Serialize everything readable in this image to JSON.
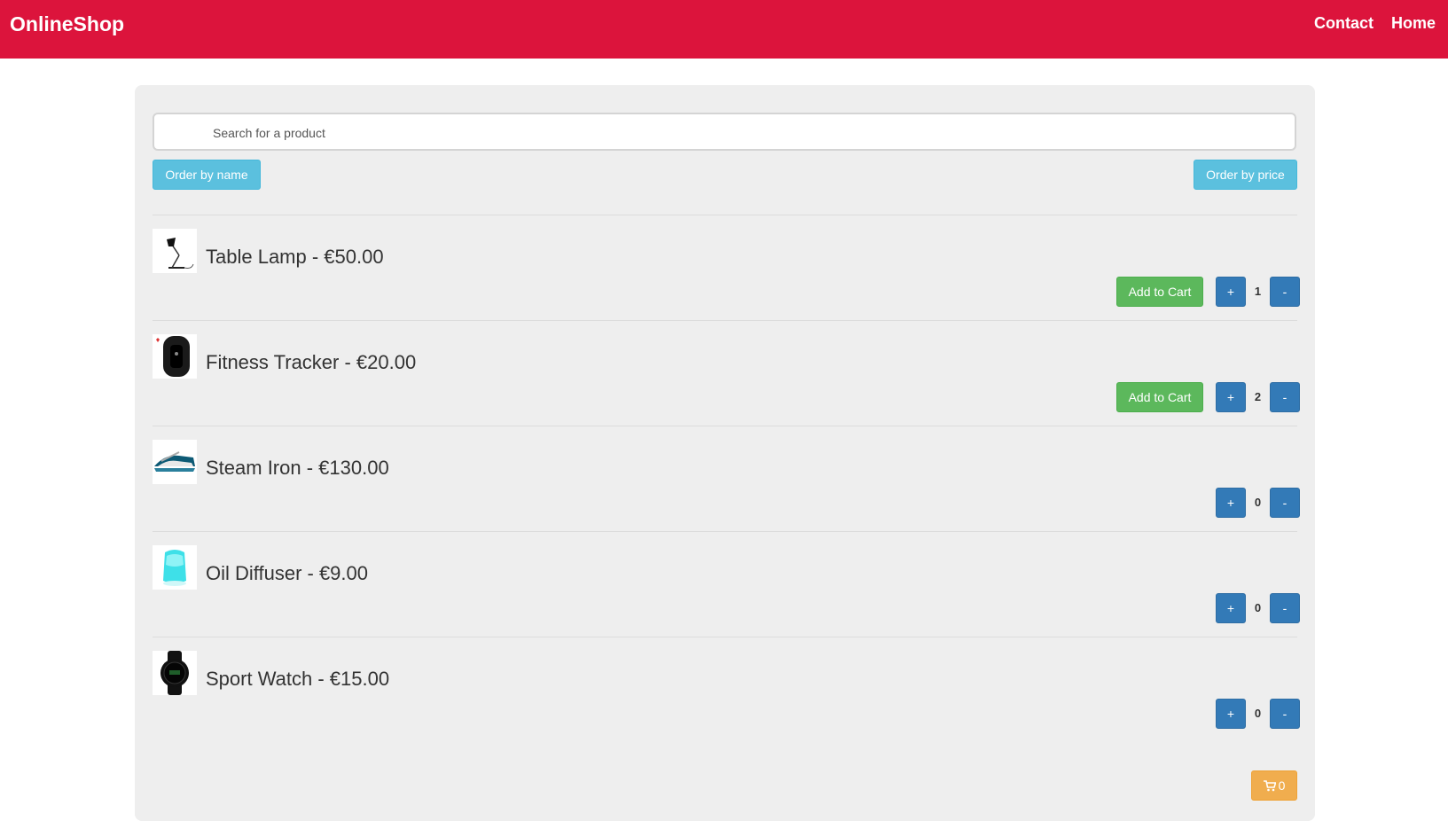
{
  "navbar": {
    "brand": "OnlineShop",
    "links": [
      "Contact",
      "Home"
    ],
    "background": "#dc143c"
  },
  "search": {
    "placeholder": "Search for a product",
    "value": ""
  },
  "controls": {
    "order_by_name": "Order by name",
    "order_by_price": "Order by price"
  },
  "products": [
    {
      "title": "Table Lamp - €50.00",
      "quantity": "1",
      "add_to_cart": "Add to Cart",
      "plus": "+",
      "minus": "-",
      "icon": "table-lamp-icon"
    },
    {
      "title": "Fitness Tracker - €20.00",
      "quantity": "2",
      "add_to_cart": "Add to Cart",
      "plus": "+",
      "minus": "-",
      "icon": "fitness-tracker-icon"
    },
    {
      "title": "Steam Iron - €130.00",
      "quantity": "0",
      "plus": "+",
      "minus": "-",
      "icon": "steam-iron-icon"
    },
    {
      "title": "Oil Diffuser - €9.00",
      "quantity": "0",
      "plus": "+",
      "minus": "-",
      "icon": "oil-diffuser-icon"
    },
    {
      "title": "Sport Watch - €15.00",
      "quantity": "0",
      "plus": "+",
      "minus": "-",
      "icon": "sport-watch-icon"
    }
  ],
  "cart": {
    "count": "0",
    "icon": "shopping-cart-icon"
  },
  "colors": {
    "accent": "#dc143c",
    "info": "#5bc0de",
    "success": "#5cb85c",
    "primary": "#337ab7",
    "warning": "#f0ad4e",
    "panel": "#eeeeee"
  }
}
